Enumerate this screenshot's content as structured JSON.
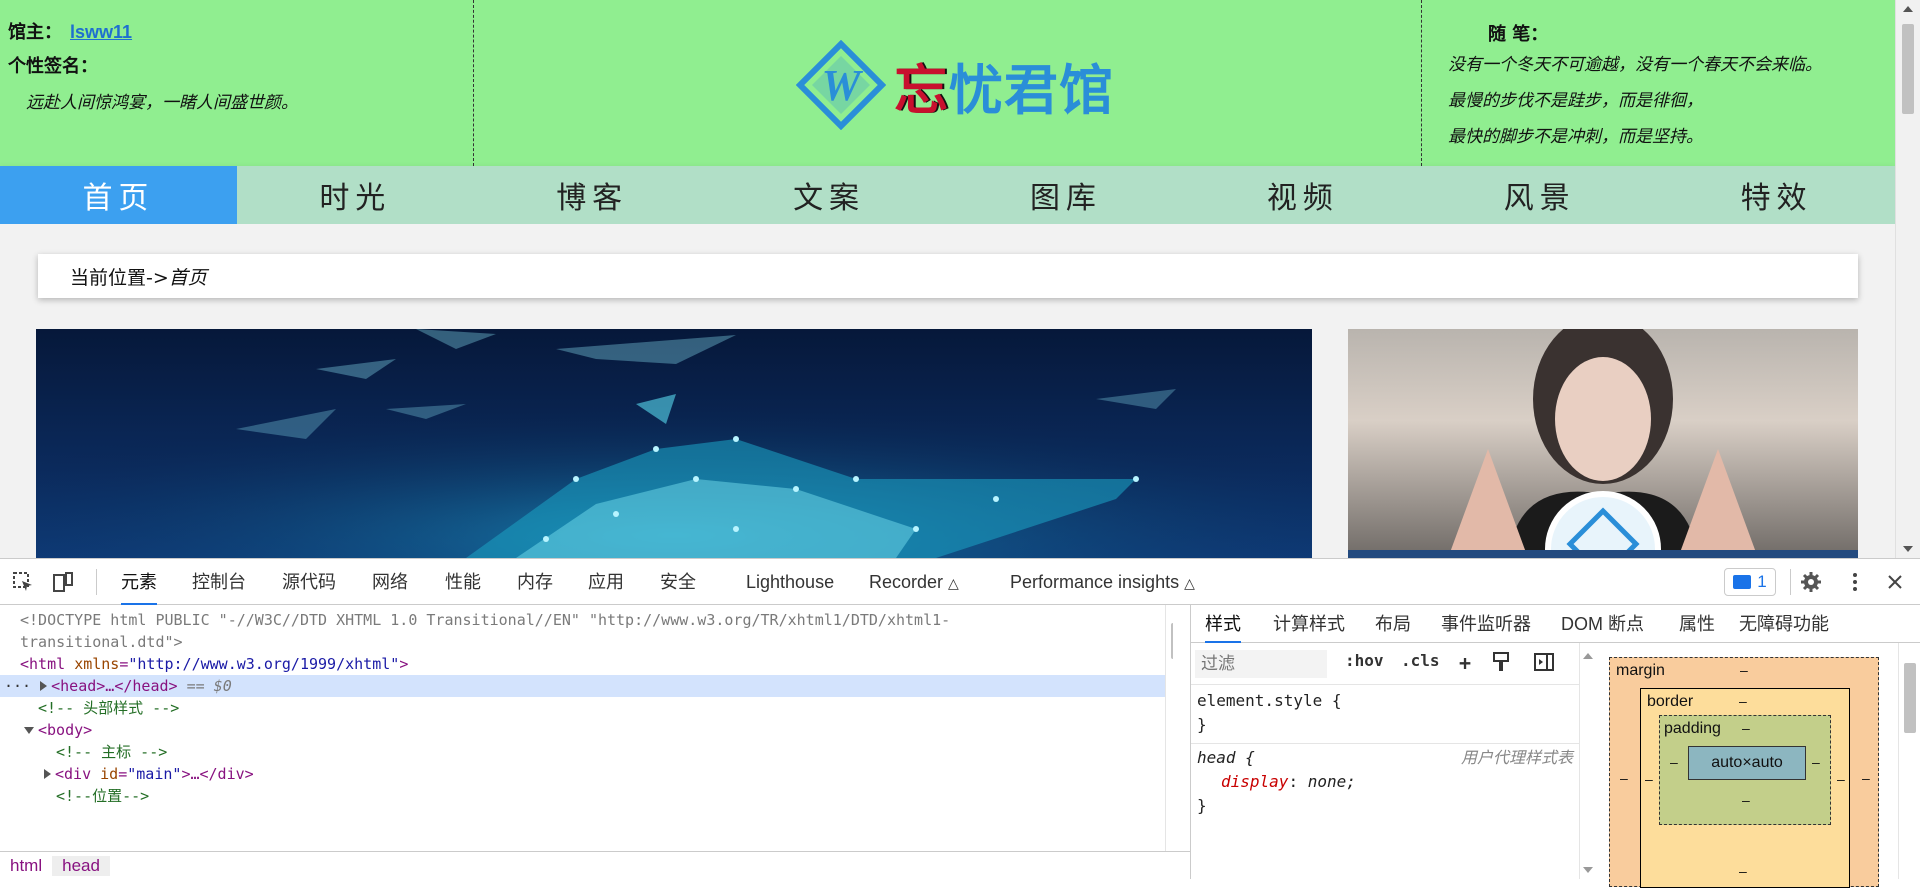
{
  "header": {
    "owner_label": "馆主：",
    "owner_name": "lsww11",
    "signature_label": "个性签名：",
    "signature_text": "远赴人间惊鸿宴，一睹人间盛世颜。",
    "logo_text_first": "忘",
    "logo_text_rest": "忧君馆",
    "note_label": "随 笔：",
    "note_lines": [
      "没有一个冬天不可逾越，没有一个春天不会来临。",
      "最慢的步伐不是跬步，而是徘徊，",
      "最快的脚步不是冲刺，而是坚持。"
    ],
    "bg_color": "#90ee90"
  },
  "nav": {
    "items": [
      "首页",
      "时光",
      "博客",
      "文案",
      "图库",
      "视频",
      "风景",
      "特效"
    ],
    "active_index": 0,
    "active_color": "#3ca0f0"
  },
  "breadcrumb": {
    "prefix": "当前位置->",
    "current": "首页"
  },
  "devtools": {
    "tabs": [
      "元素",
      "控制台",
      "源代码",
      "网络",
      "性能",
      "内存",
      "应用",
      "安全",
      "Lighthouse",
      "Recorder",
      "Performance insights"
    ],
    "active_tab": "元素",
    "issues_count": "1",
    "code": {
      "doctype_1": "<!DOCTYPE html PUBLIC \"-//W3C//DTD XHTML 1.0 Transitional//EN\" \"http://www.w3.org/TR/xhtml1/DTD/xhtml1-",
      "doctype_2": "transitional.dtd\">",
      "html_tag": "<html",
      "html_attr": "xmlns",
      "html_val": "\"http://www.w3.org/1999/xhtml\"",
      "head_tag": "<head>…</head>",
      "eq0": "== $0",
      "comment_header": "<!-- 头部样式 -->",
      "body_tag": "<body>",
      "comment_main": "<!-- 主标 -->",
      "div_tag": "<div",
      "div_attr": "id",
      "div_val": "\"main\"",
      "div_close": ">…</div>",
      "comment_pos": "<!--位置-->"
    },
    "crumbs": [
      "html",
      "head"
    ],
    "style_tabs": [
      "样式",
      "计算样式",
      "布局",
      "事件监听器",
      "DOM 断点",
      "属性",
      "无障碍功能"
    ],
    "filter_placeholder": "过滤",
    "hov": ":hov",
    "cls": ".cls",
    "element_style_open": "element.style {",
    "close_brace": "}",
    "head_rule_selector": "head {",
    "ua_label": "用户代理样式表",
    "prop_name": "display",
    "prop_value": "none;",
    "box_model": {
      "margin": "margin",
      "border": "border",
      "padding": "padding",
      "content": "auto×auto",
      "dash": "–"
    }
  }
}
